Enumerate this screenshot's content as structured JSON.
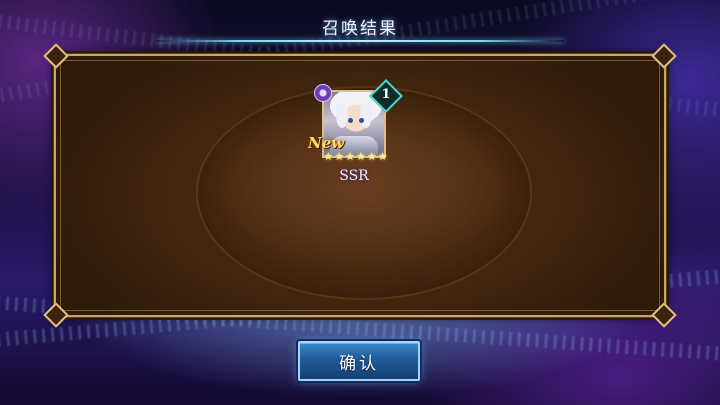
{
  "screen": {
    "title": "召唤结果"
  },
  "result_card": {
    "new_label": "New",
    "count": "1",
    "stars": "★★★★★★",
    "rarity": "SSR",
    "element_icon": "dark-element-icon",
    "portrait": "white-haired-character-portrait"
  },
  "confirm_button": {
    "label": "确认"
  },
  "colors": {
    "panel_border": "#c9a764",
    "panel_fill": "#43260f",
    "button_fill": "#1f5b98",
    "title_line": "#7ed8f0"
  }
}
